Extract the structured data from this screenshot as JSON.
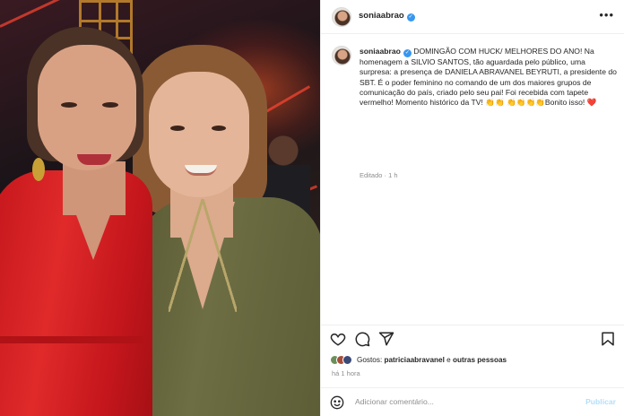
{
  "post": {
    "username": "soniaabrao",
    "caption_text": "DOMINGÃO COM HUCK/ MELHORES DO ANO! Na homenagem a SILVIO SANTOS, tão aguardada pelo público, uma surpresa: a presença de DANIELA ABRAVANEL BEYRUTI, a presidente do SBT. É o poder feminino no comando de um dos maiores grupos de comunicação do país, criado pelo seu pai! Foi recebida com tapete vermelho! Momento histórico da TV! 👏👏 👏👏👏👏Bonito isso! ❤️",
    "caption_meta": "Editado · 1 h",
    "more_icon": "more-horizontal-icon"
  },
  "likes": {
    "prefix": "Gostos:",
    "user": "patriciaabravanel",
    "middle": "e",
    "others": "outras pessoas"
  },
  "time_ago": "há 1 hora",
  "comment": {
    "placeholder": "Adicionar comentário...",
    "post_label": "Publicar"
  },
  "icons": [
    "heart-icon",
    "comment-icon",
    "share-icon",
    "bookmark-icon",
    "emoji-icon",
    "verified-badge-icon"
  ],
  "colors": {
    "verified": "#3897f0",
    "post_button_disabled": "#b2dffc",
    "meta_text": "#8e8e8e"
  }
}
